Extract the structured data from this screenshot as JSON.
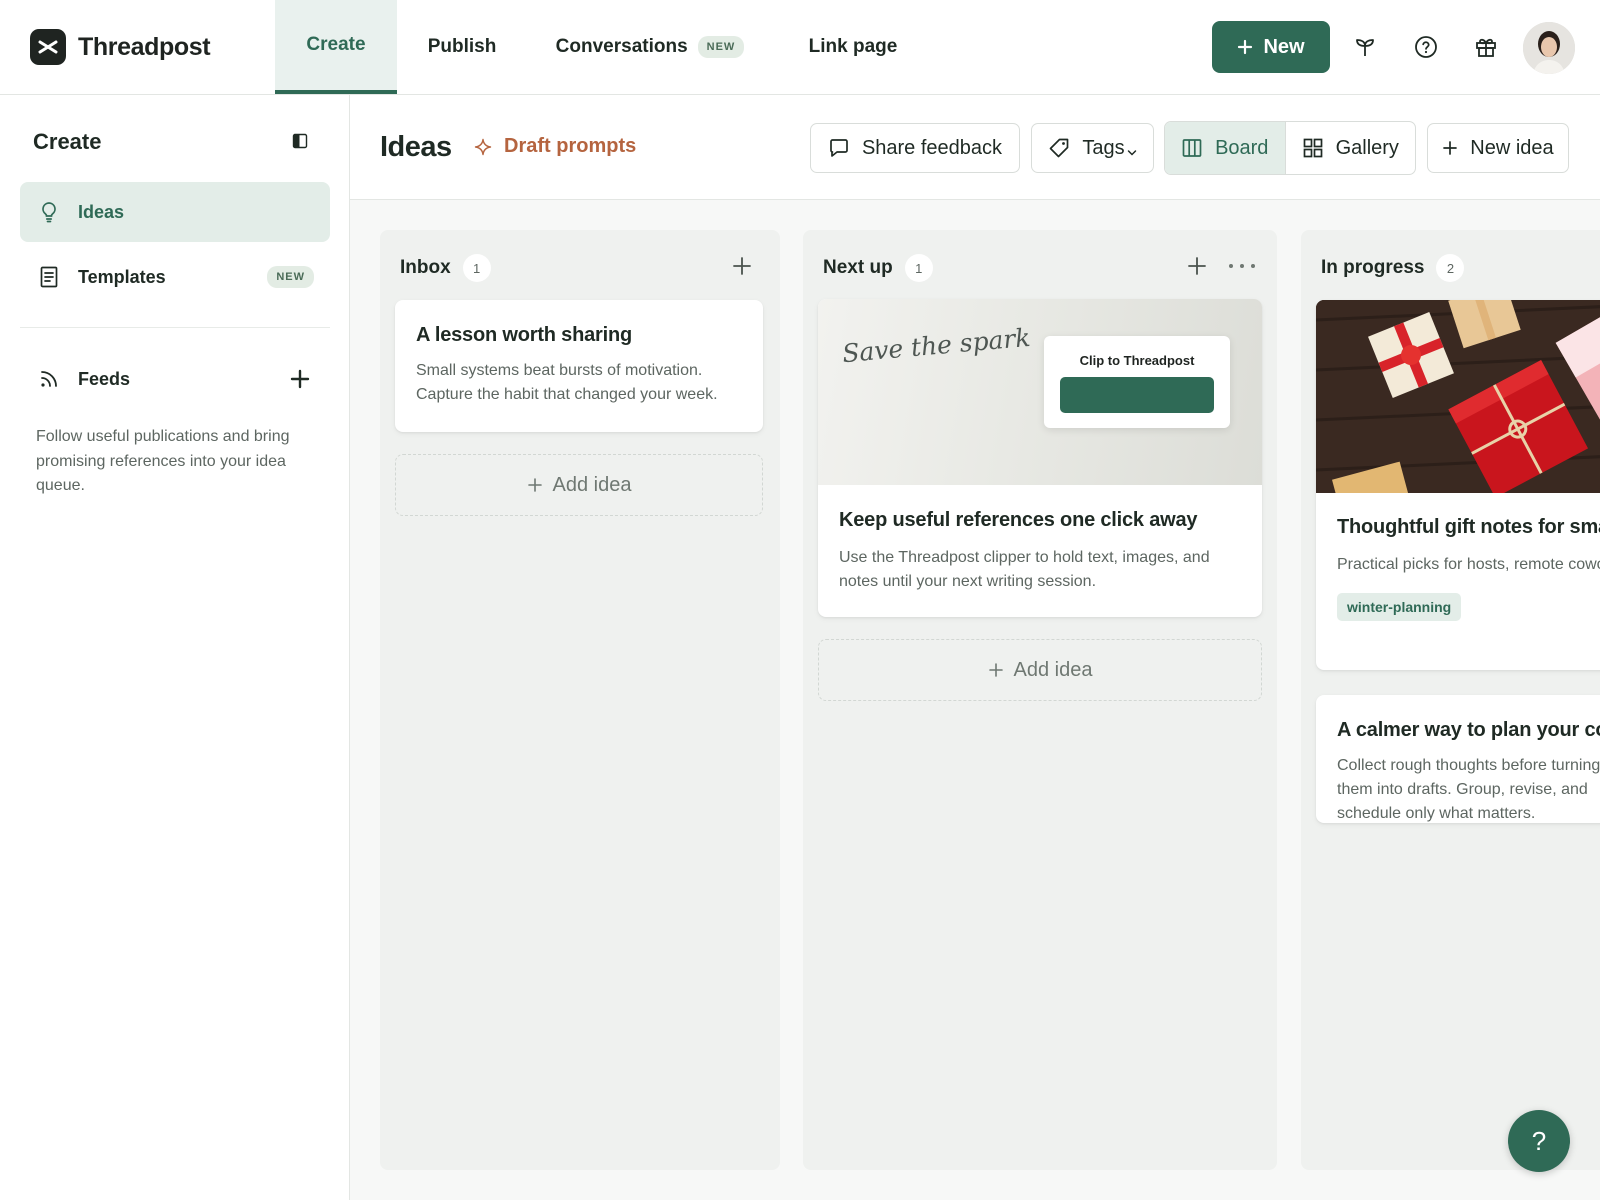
{
  "app": {
    "name": "Threadpost"
  },
  "nav": {
    "tabs": [
      {
        "label": "Create"
      },
      {
        "label": "Publish"
      },
      {
        "label": "Conversations",
        "badge": "NEW"
      },
      {
        "label": "Link page"
      }
    ],
    "new_button": "New"
  },
  "sidebar": {
    "title": "Create",
    "items": [
      {
        "label": "Ideas"
      },
      {
        "label": "Templates",
        "badge": "NEW"
      }
    ],
    "feeds": {
      "label": "Feeds",
      "description": "Follow useful publications and bring promising references into your idea queue."
    }
  },
  "header": {
    "title": "Ideas",
    "draft_prompts": "Draft prompts",
    "share_feedback": "Share feedback",
    "tags": "Tags",
    "views": [
      "Board",
      "Gallery"
    ],
    "new_idea": "New idea"
  },
  "board": {
    "add_idea_label": "Add idea",
    "columns": [
      {
        "name": "Inbox",
        "count": "1",
        "cards": [
          {
            "title": "A lesson worth sharing",
            "text": "Small systems beat bursts of motivation. Capture the habit that changed your week."
          }
        ]
      },
      {
        "name": "Next up",
        "count": "1",
        "cards": [
          {
            "image_script": "Save the spark",
            "image_popup": "Clip to Threadpost",
            "title": "Keep useful references one click away",
            "text": "Use the Threadpost clipper to hold text, images, and notes until your next writing session."
          }
        ]
      },
      {
        "name": "In progress",
        "count": "2",
        "cards": [
          {
            "title": "Thoughtful gift notes for small budgets",
            "text": "Practical picks for hosts, remote coworkers, and last-minute swaps.",
            "tag": "winter-planning"
          },
          {
            "title": "A calmer way to plan your content week",
            "text": "Collect rough thoughts before turning them into drafts. Group, revise, and schedule only what matters."
          }
        ]
      }
    ]
  },
  "help_button": "?",
  "colors": {
    "accent": "#2f6a56",
    "accent_light": "#e3ede8",
    "draft": "#b5643f",
    "logo": "#1f2421"
  }
}
